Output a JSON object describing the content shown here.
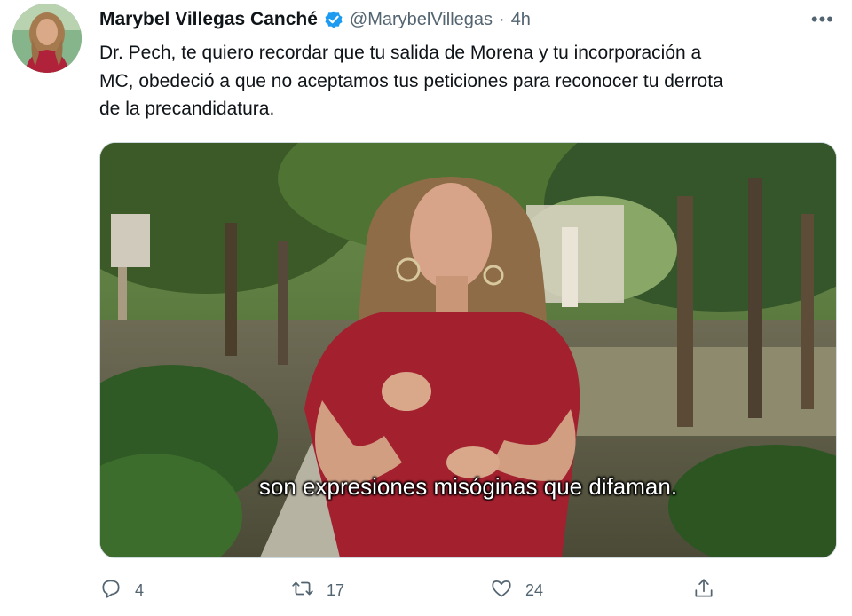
{
  "tweet": {
    "author": {
      "display_name": "Marybel Villegas Canché",
      "handle": "@MarybelVillegas",
      "verified_icon": "verified-badge-icon",
      "avatar_icon": "avatar"
    },
    "separator": "·",
    "time": "4h",
    "more_label": "•••",
    "text": "Dr. Pech, te quiero recordar que tu salida de Morena y tu incorporación a\nMC, obedeció a que no aceptamos tus peticiones para reconocer tu derrota\nde la precandidatura.",
    "media": {
      "subtitle": "son expresiones misóginas que difaman."
    },
    "actions": {
      "reply": {
        "icon": "reply-icon",
        "count": "4"
      },
      "retweet": {
        "icon": "retweet-icon",
        "count": "17"
      },
      "like": {
        "icon": "heart-icon",
        "count": "24"
      },
      "share": {
        "icon": "share-icon"
      }
    },
    "colors": {
      "verified": "#1d9bf0",
      "secondary_text": "#536471",
      "dress": "#a3202f"
    }
  }
}
